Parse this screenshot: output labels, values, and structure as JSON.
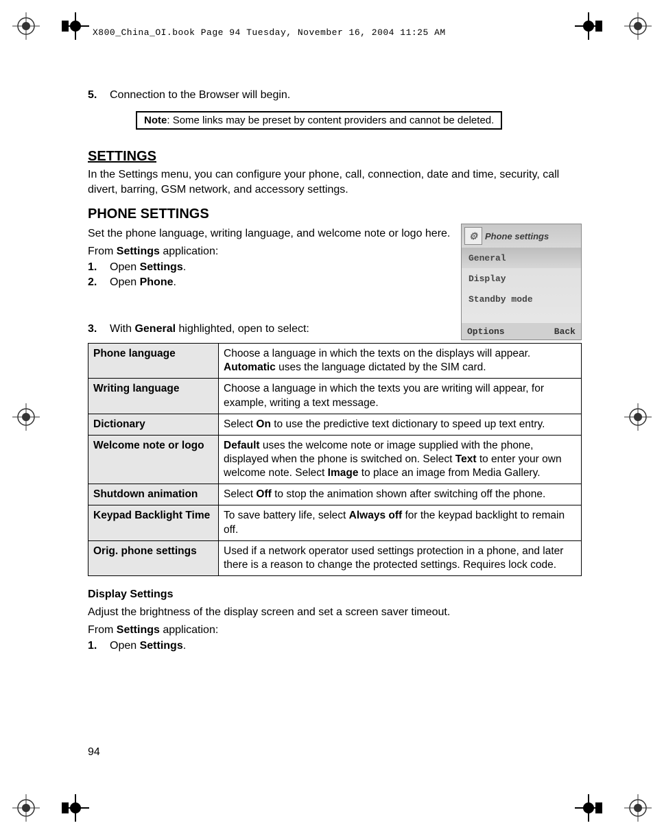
{
  "header_line": "X800_China_OI.book  Page 94  Tuesday, November 16, 2004  11:25 AM",
  "step5": {
    "num": "5.",
    "text": "Connection to the Browser will begin."
  },
  "note": {
    "label": "Note",
    "text": "Some links may be preset by content providers and cannot be deleted."
  },
  "settings": {
    "heading": "SETTINGS",
    "intro": "In the Settings menu, you can configure your phone, call, connection, date and time, security, call divert, barring, GSM network, and accessory settings."
  },
  "phone_settings": {
    "heading": "PHONE SETTINGS",
    "intro": "Set the phone language, writing language, and welcome note or logo here.",
    "from": "From ",
    "from_bold": "Settings",
    "from_after": " application:",
    "step1": {
      "num": "1.",
      "pre": "Open ",
      "bold": "Settings",
      "post": "."
    },
    "step2": {
      "num": "2.",
      "pre": "Open ",
      "bold": "Phone",
      "post": "."
    },
    "step3": {
      "num": "3.",
      "pre": "With ",
      "bold": "General",
      "post": " highlighted, open to select:"
    }
  },
  "screenshot": {
    "title": "Phone settings",
    "row1": "General",
    "row2": "Display",
    "row3": "Standby mode",
    "left_soft": "Options",
    "right_soft": "Back"
  },
  "table": [
    {
      "label": "Phone language",
      "desc_pre": "Choose a language in which the texts on the displays will appear. ",
      "b1": "Automatic",
      "desc_post": " uses the language dictated by the SIM card."
    },
    {
      "label": "Writing language",
      "desc_pre": "Choose a language in which the texts you are writing will appear, for example, writing a text message.",
      "b1": "",
      "desc_post": ""
    },
    {
      "label": "Dictionary",
      "desc_pre": "Select ",
      "b1": "On",
      "desc_post": " to use the predictive text dictionary to speed up text entry."
    },
    {
      "label": "Welcome note or logo",
      "desc_pre": "",
      "b1": "Default",
      "desc_post": " uses the welcome note or image supplied with the phone, displayed when the phone is switched on. Select ",
      "b2": "Text",
      "desc_post2": " to enter your own welcome note. Select ",
      "b3": "Image",
      "desc_post3": " to place an image from Media Gallery."
    },
    {
      "label": "Shutdown animation",
      "desc_pre": "Select ",
      "b1": "Off",
      "desc_post": " to stop the animation shown after switching off the phone."
    },
    {
      "label": "Keypad Backlight Time",
      "desc_pre": "To save battery life, select ",
      "b1": "Always off",
      "desc_post": " for the keypad backlight to remain off."
    },
    {
      "label": "Orig. phone settings",
      "desc_pre": "Used if a network operator used settings protection in a phone, and later there is a reason to change the protected settings. Requires lock code.",
      "b1": "",
      "desc_post": ""
    }
  ],
  "display_settings": {
    "heading": "Display Settings",
    "intro": "Adjust the brightness of the display screen and set a screen saver timeout.",
    "from": "From ",
    "from_bold": "Settings",
    "from_after": " application:",
    "step1": {
      "num": "1.",
      "pre": "Open ",
      "bold": "Settings",
      "post": "."
    }
  },
  "page_number": "94"
}
